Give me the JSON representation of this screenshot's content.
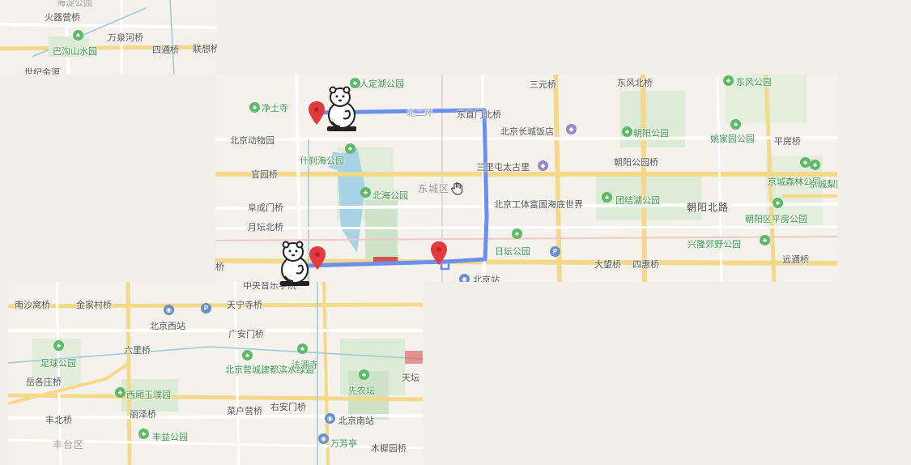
{
  "map": {
    "route_color": "#6b8ff0",
    "marker_color": "#e23b3b",
    "park_color": "#3c9a4c",
    "icons": [
      "location-pin-icon",
      "polar-bear-icon",
      "hand-cursor-icon",
      "park-icon",
      "station-icon",
      "parking-icon",
      "shopping-icon"
    ]
  },
  "labels_top_left": {
    "huoqiying": "火器营桥",
    "wanquanhe": "万泉河桥",
    "bashanshan": "巴沟山水园",
    "sitong": "四通桥",
    "lianxiang": "联想桥",
    "shijijincheng": "世纪金源",
    "top_cut": "海淀公园"
  },
  "labels_center": {
    "rendinghu": "人定湖公园",
    "sanyuan": "三元桥",
    "dongfengbei": "东风北桥",
    "dongfeng": "东风公园",
    "jingtusi": "净土寺",
    "beierhuan": "北二环",
    "dongzhimen": "东直门北桥",
    "changcheng": "北京长城饭店",
    "chaoyang_park": "朝阳公园",
    "yaojiayuan": "姚家园公园",
    "pingfang_bridge": "平房桥",
    "dongwuyuan": "北京动物园",
    "shichahai": "什刹海公园",
    "sanlitun": "三里屯太古里",
    "chaoyang_bridge": "朝阳公园桥",
    "guanyuan": "官园桥",
    "beihai": "北海公园",
    "dongcheng": "东城区",
    "gongti": "北京工体富国海底世界",
    "wanliu": "团结湖公园",
    "jingcheng": "京城森林公园",
    "jingcheng_li": "京城梨园",
    "fuchengmen": "阜成门桥",
    "chaoyangbei": "朝阳北路",
    "pingfang": "朝阳区平房公园",
    "yuetan": "月坛北桥",
    "ritan": "日坛公园",
    "xinglong": "兴隆郊野公园",
    "fuxingmen": "桥",
    "dawang": "大望桥",
    "sihui": "四惠桥",
    "yuantong": "远通桥",
    "beijing_station": "北京站",
    "center_dong": "东城区"
  },
  "labels_bottom_left": {
    "zhongyangyinyue": "中央音乐学院",
    "nanshawo": "南沙窝桥",
    "jinjiacun": "金家村桥",
    "tianning": "天宁寺桥",
    "beijingxi": "北京西站",
    "guanganmen": "广安门桥",
    "liuli": "六里桥",
    "zuqiu": "足球公园",
    "beijing_yingcheng": "北京营城建都滨水绿道",
    "fayuansi": "法源寺",
    "tiantan": "天坛",
    "yuezhuang": "岳各庄桥",
    "xiyuanyu": "西厢玉璞园",
    "xiannongtan": "先农坛",
    "fengbei": "丰北桥",
    "lize": "丽泽桥",
    "caihukou": "菜户营桥",
    "youanmen": "右安门桥",
    "beijingnan": "北京南站",
    "fengtai": "丰台区",
    "fengyi": "丰益公园",
    "wanfang": "万芳亭",
    "muxiyuan": "木樨园桥"
  }
}
